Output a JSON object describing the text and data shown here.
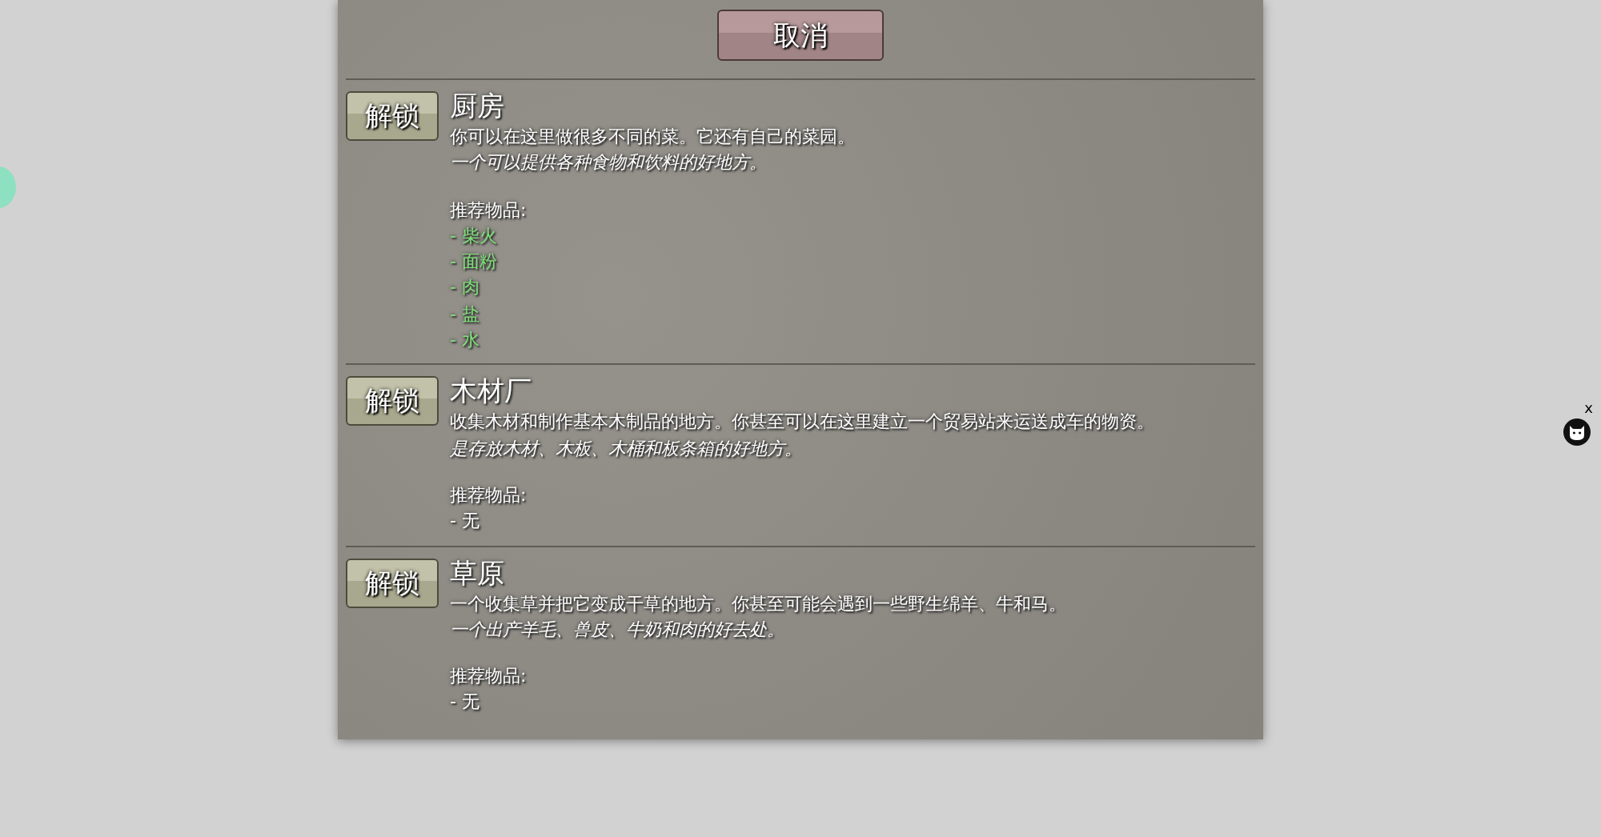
{
  "cancel_button": "取消",
  "buildings": [
    {
      "button": "解锁",
      "title": "厨房",
      "description": "你可以在这里做很多不同的菜。它还有自己的菜园。",
      "note": "一个可以提供各种食物和饮料的好地方。",
      "items_label": "推荐物品:",
      "items": [
        {
          "text": "- 柴火",
          "owned": true
        },
        {
          "text": "- 面粉",
          "owned": true
        },
        {
          "text": "- 肉",
          "owned": true
        },
        {
          "text": "- 盐",
          "owned": true
        },
        {
          "text": "- 水",
          "owned": true
        }
      ]
    },
    {
      "button": "解锁",
      "title": "木材厂",
      "description": "收集木材和制作基本木制品的地方。你甚至可以在这里建立一个贸易站来运送成车的物资。",
      "note": "是存放木材、木板、木桶和板条箱的好地方。",
      "items_label": "推荐物品:",
      "items": [
        {
          "text": "- 无",
          "owned": false
        }
      ]
    },
    {
      "button": "解锁",
      "title": "草原",
      "description": "一个收集草并把它变成干草的地方。你甚至可能会遇到一些野生绵羊、牛和马。",
      "note": "一个出产羊毛、兽皮、牛奶和肉的好去处。",
      "items_label": "推荐物品:",
      "items": [
        {
          "text": "- 无",
          "owned": false
        }
      ]
    }
  ],
  "close_mark": "x"
}
